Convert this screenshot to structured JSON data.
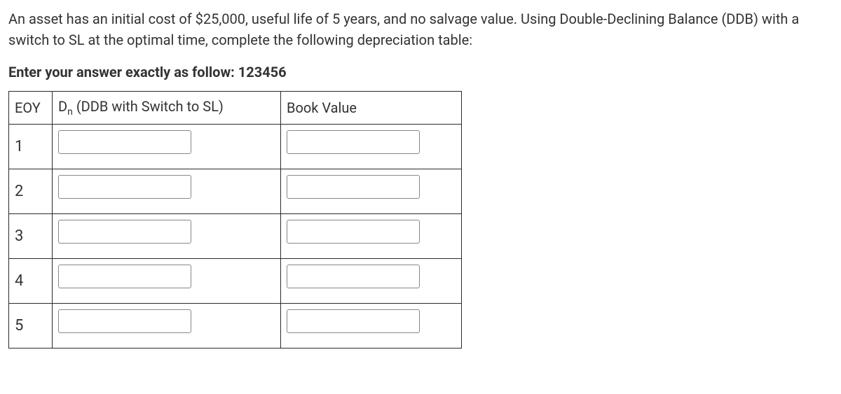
{
  "question": "An asset has an initial cost of $25,000, useful life of 5 years, and no salvage value. Using Double-Declining Balance (DDB) with a switch to SL at the optimal time, complete the following depreciation table:",
  "instruction": "Enter your answer exactly as follow: 123456",
  "headers": {
    "eoy": "EOY",
    "dn_prefix": "D",
    "dn_sub": "n",
    "dn_suffix": " (DDB with Switch to SL)",
    "bv": "Book Value"
  },
  "rows": [
    {
      "eoy": "1",
      "dn": "",
      "bv": ""
    },
    {
      "eoy": "2",
      "dn": "",
      "bv": ""
    },
    {
      "eoy": "3",
      "dn": "",
      "bv": ""
    },
    {
      "eoy": "4",
      "dn": "",
      "bv": ""
    },
    {
      "eoy": "5",
      "dn": "",
      "bv": ""
    }
  ]
}
